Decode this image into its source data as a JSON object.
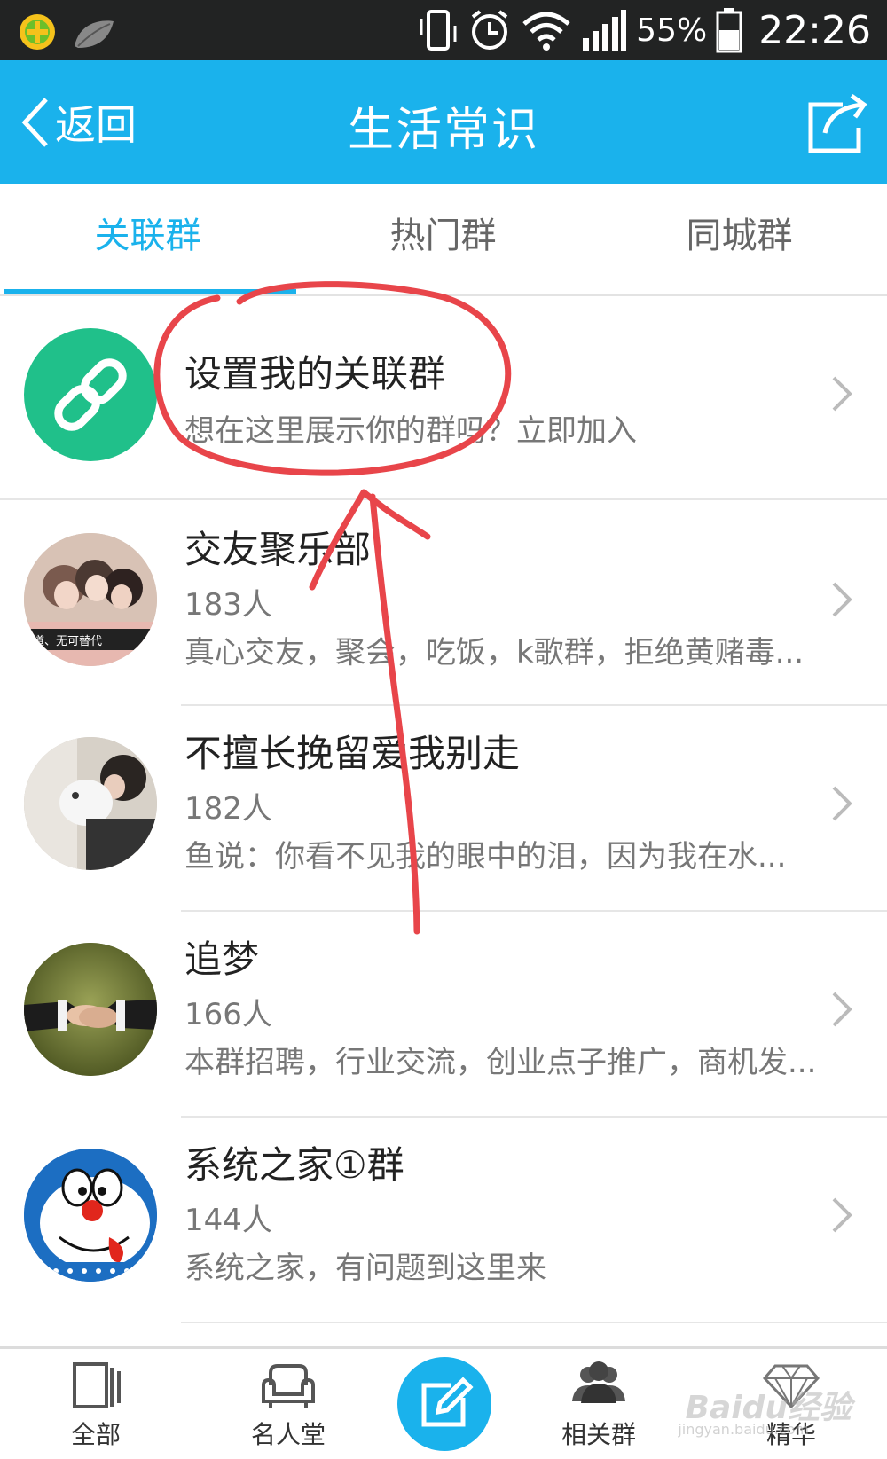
{
  "status_bar": {
    "battery_percent": "55%",
    "time": "22:26"
  },
  "header": {
    "back_label": "返回",
    "title": "生活常识",
    "accent_color": "#1ab2ec"
  },
  "tabs": [
    {
      "label": "关联群",
      "active": true
    },
    {
      "label": "热门群",
      "active": false
    },
    {
      "label": "同城群",
      "active": false
    }
  ],
  "link_group": {
    "icon": "link-icon",
    "title": "设置我的关联群",
    "subtitle": "想在这里展示你的群吗？立即加入",
    "icon_color": "#20c08a"
  },
  "groups": [
    {
      "name": "交友聚乐部",
      "members": "183人",
      "description": "真心交友，聚会，吃饭，k歌群，拒绝黄赌毒...",
      "avatar_caption": "道、无可替代"
    },
    {
      "name": "不擅长挽留爱我别走",
      "members": "182人",
      "description": "鱼说：你看不见我的眼中的泪，因为我在水..."
    },
    {
      "name": "追梦",
      "members": "166人",
      "description": "本群招聘，行业交流，创业点子推广，商机发..."
    },
    {
      "name": "系统之家①群",
      "members": "144人",
      "description": "系统之家，有问题到这里来"
    }
  ],
  "bottom_nav": {
    "items": [
      {
        "label": "全部",
        "icon": "panels-icon"
      },
      {
        "label": "名人堂",
        "icon": "sofa-icon"
      },
      {
        "label": "相关群",
        "icon": "people-icon"
      },
      {
        "label": "精华",
        "icon": "diamond-icon"
      }
    ],
    "compose_icon": "edit-icon"
  },
  "watermark": {
    "brand": "Baidu经验",
    "url": "jingyan.baidu.com"
  },
  "annotation_color": "#e8454a"
}
